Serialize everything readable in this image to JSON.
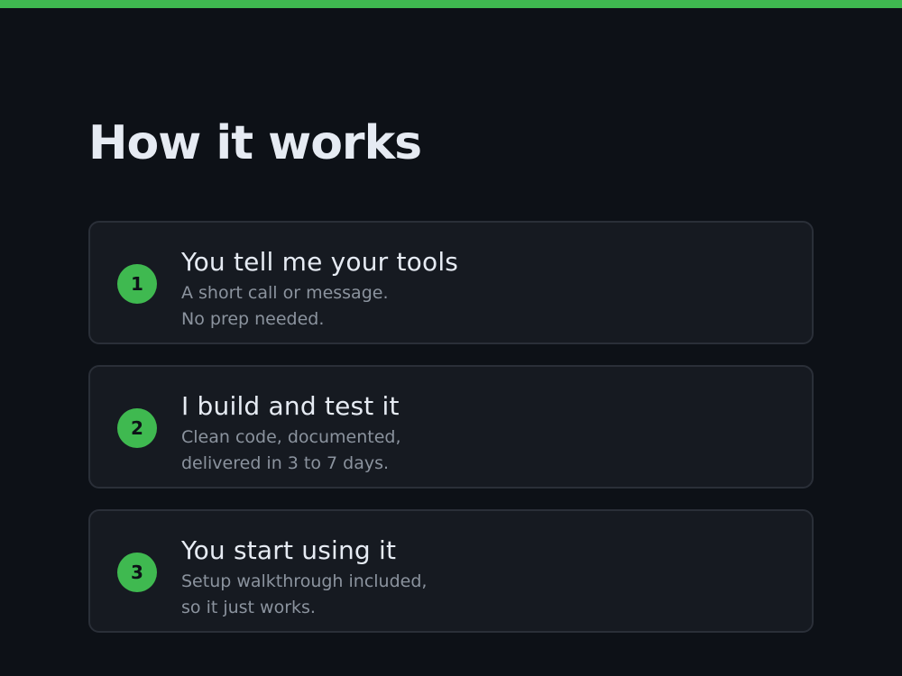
{
  "colors": {
    "background": "#0d1117",
    "accent": "#3fb950",
    "card_background": "#161a21",
    "card_border": "#2a2f38",
    "title_text": "#e6ebf3",
    "muted_text": "#8b939e"
  },
  "section": {
    "title": "How it works"
  },
  "steps": [
    {
      "number": "1",
      "title": "You tell me your tools",
      "desc_line1": "A short call or message.",
      "desc_line2": "No prep needed."
    },
    {
      "number": "2",
      "title": "I build and test it",
      "desc_line1": "Clean code, documented,",
      "desc_line2": "delivered in 3 to 7 days."
    },
    {
      "number": "3",
      "title": "You start using it",
      "desc_line1": "Setup walkthrough included,",
      "desc_line2": "so it just works."
    }
  ]
}
